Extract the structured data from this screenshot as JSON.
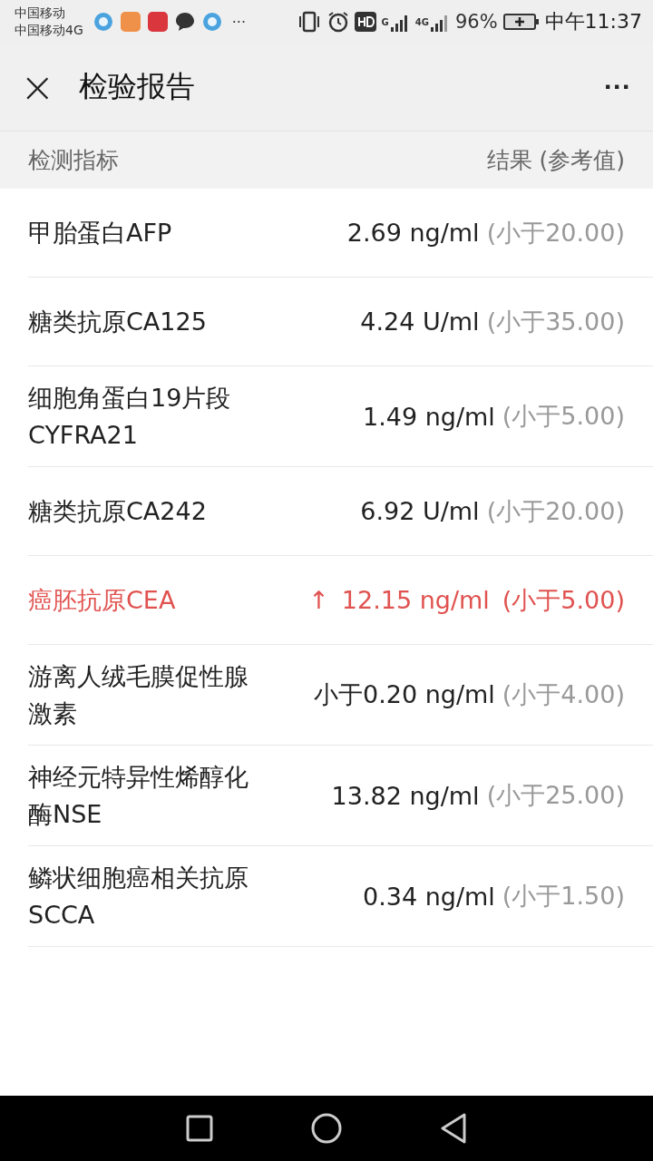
{
  "status_bar": {
    "carrier_1": "中国移动",
    "carrier_2": "中国移动4G",
    "more": "···",
    "net_1": "G",
    "net_2": "4G",
    "battery": "96%",
    "time": "中午11:37"
  },
  "header": {
    "close": "×",
    "title": "检验报告",
    "menu": "···"
  },
  "columns": [
    "检测指标",
    "结果 (参考值)"
  ],
  "rows": [
    {
      "name": "甲胎蛋白AFP",
      "value": "2.69 ng/ml",
      "reference": "(小于20.00)",
      "abnormal": false
    },
    {
      "name": "糖类抗原CA125",
      "value": "4.24 U/ml",
      "reference": "(小于35.00)",
      "abnormal": false
    },
    {
      "name": "细胞角蛋白19片段CYFRA21",
      "value": "1.49 ng/ml",
      "reference": "(小于5.00)",
      "abnormal": false
    },
    {
      "name": "糖类抗原CA242",
      "value": "6.92 U/ml",
      "reference": "(小于20.00)",
      "abnormal": false
    },
    {
      "name": "癌胚抗原CEA",
      "arrow": "↑",
      "value": "12.15 ng/ml",
      "reference": "(小于5.00)",
      "abnormal": true
    },
    {
      "name": "游离人绒毛膜促性腺激素",
      "value": "小于0.20 ng/ml",
      "reference": "(小于4.00)",
      "abnormal": false
    },
    {
      "name": "神经元特异性烯醇化酶NSE",
      "value": "13.82 ng/ml",
      "reference": "(小于25.00)",
      "abnormal": false
    },
    {
      "name": "鳞状细胞癌相关抗原SCCA",
      "value": "0.34 ng/ml",
      "reference": "(小于1.50)",
      "abnormal": false
    }
  ]
}
